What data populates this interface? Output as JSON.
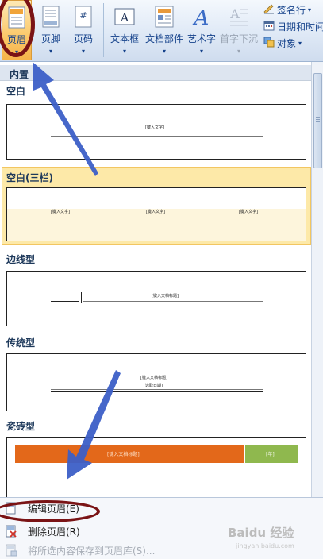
{
  "ribbon": {
    "header_btn": "页眉",
    "footer_btn": "页脚",
    "page_number_btn": "页码",
    "textbox_btn": "文本框",
    "quickparts_btn": "文档部件",
    "wordart_btn": "艺术字",
    "dropcap_btn": "首字下沉",
    "signature_line": "签名行",
    "date_time": "日期和时间",
    "object": "对象",
    "dropdown_glyph": "▾"
  },
  "gallery": {
    "section_header": "内置",
    "items": [
      {
        "label": "空白",
        "placeholder": "[键入文字]"
      },
      {
        "label": "空白(三栏)",
        "placeholders": [
          "[键入文字]",
          "[键入文字]",
          "[键入文字]"
        ]
      },
      {
        "label": "边线型",
        "placeholder": "[键入文档标题]"
      },
      {
        "label": "传统型",
        "placeholder": "[键入文档标题]",
        "placeholder2": "[选取日期]"
      },
      {
        "label": "瓷砖型",
        "placeholder": "[键入文档标题]",
        "placeholder2": "[年]"
      }
    ]
  },
  "menu": {
    "edit_header": "编辑页眉(E)",
    "remove_header": "删除页眉(R)",
    "save_selection": "将所选内容保存到页眉库(S)..."
  },
  "colors": {
    "accent_orange": "#e3681a",
    "accent_green": "#8fb84e",
    "highlight": "#fde9a8",
    "annotation_red": "#7a1315",
    "arrow_blue": "#3c5fc7"
  },
  "watermark": "Baidu 经验",
  "watermark_url": "jingyan.baidu.com"
}
